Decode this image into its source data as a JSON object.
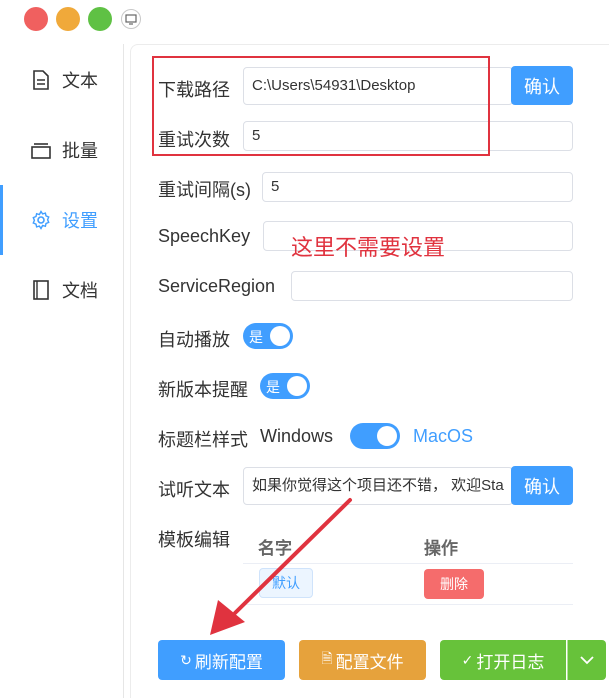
{
  "sidebar": {
    "items": [
      {
        "label": "文本",
        "icon": "document-icon"
      },
      {
        "label": "批量",
        "icon": "layers-icon"
      },
      {
        "label": "设置",
        "icon": "gear-icon"
      },
      {
        "label": "文档",
        "icon": "book-icon"
      }
    ],
    "active_index": 2
  },
  "settings": {
    "download_path": {
      "label": "下载路径",
      "value": "C:\\Users\\54931\\Desktop",
      "confirm": "确认"
    },
    "retry_count": {
      "label": "重试次数",
      "value": "5"
    },
    "retry_interval": {
      "label": "重试间隔(s)",
      "value": "5"
    },
    "speech_key": {
      "label": "SpeechKey",
      "value": ""
    },
    "service_region": {
      "label": "ServiceRegion",
      "value": ""
    },
    "auto_play": {
      "label": "自动播放",
      "state": "是"
    },
    "update_notice": {
      "label": "新版本提醒",
      "state": "是"
    },
    "titlebar_style": {
      "label": "标题栏样式",
      "off_label": "Windows",
      "on_label": "MacOS"
    },
    "preview_text": {
      "label": "试听文本",
      "value": "如果你觉得这个项目还不错， 欢迎Sta",
      "confirm": "确认"
    },
    "template_edit": {
      "label": "模板编辑",
      "col_name": "名字",
      "col_action": "操作",
      "rows": [
        {
          "name": "默认",
          "action": "删除"
        }
      ]
    }
  },
  "annotation": {
    "note": "这里不需要设置"
  },
  "footer": {
    "refresh": "刷新配置",
    "config_file": "配置文件",
    "open_log": "打开日志"
  },
  "colors": {
    "primary": "#409eff",
    "warning": "#e6a23c",
    "success": "#67c23a",
    "danger": "#f56c6c",
    "annotation": "#e0333f"
  }
}
